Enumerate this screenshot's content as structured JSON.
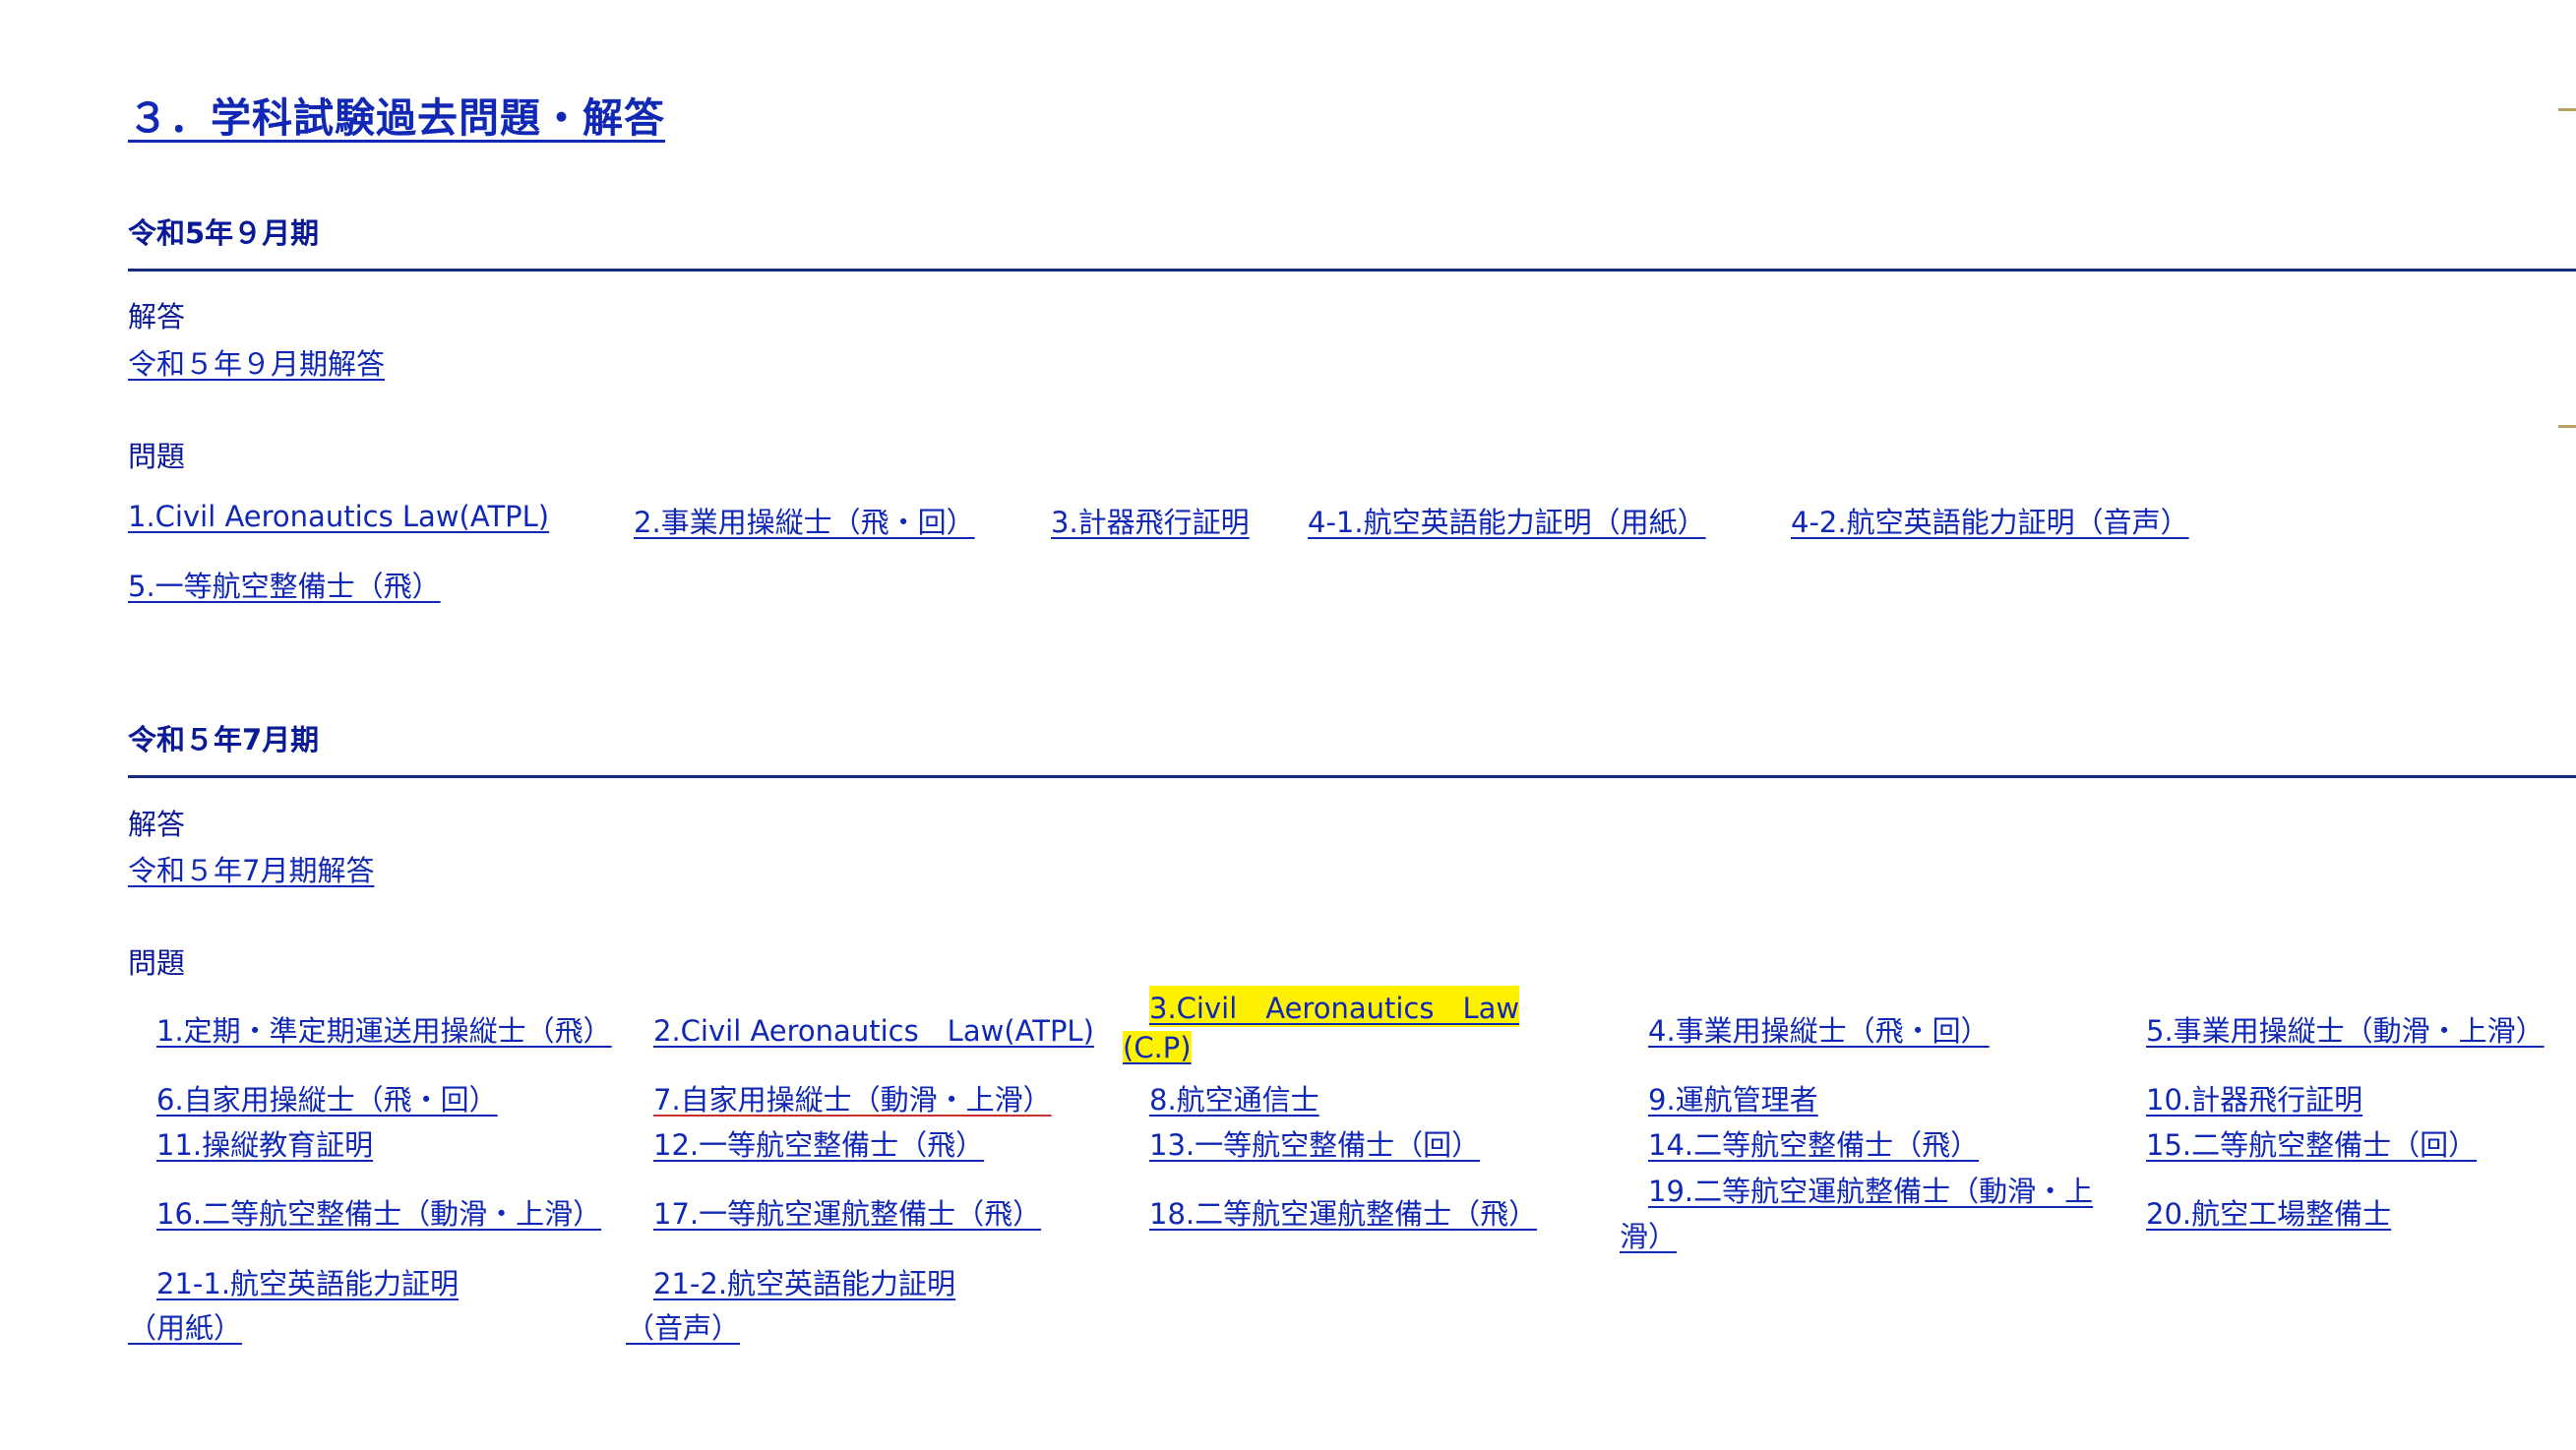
{
  "page": {
    "title": "３．学科試験過去問題・解答"
  },
  "periods": [
    {
      "title": "令和5年９月期",
      "answer_label": "解答",
      "answer_link": "令和５年９月期解答",
      "questions_label": "問題",
      "questions": [
        "1.Civil Aeronautics Law(ATPL)",
        "2.事業用操縦士（飛・回）",
        "3.計器飛行証明",
        "4-1.航空英語能力証明（用紙）",
        "4-2.航空英語能力証明（音声）",
        "5.一等航空整備士（飛）"
      ]
    },
    {
      "title": "令和５年7月期",
      "answer_label": "解答",
      "answer_link": "令和５年7月期解答",
      "questions_label": "問題",
      "questions": [
        "1.定期・準定期運送用操縦士（飛）",
        "2.Civil Aeronautics　Law(ATPL)",
        "3.Civil　Aeronautics　Law",
        "(C.P)",
        "4.事業用操縦士（飛・回）",
        "5.事業用操縦士（動滑・上滑）",
        "6.自家用操縦士（飛・回）",
        "7.自家用操縦士（動滑・上滑）",
        "8.航空通信士",
        "9.運航管理者",
        "10.計器飛行証明",
        "11.操縦教育証明",
        "12.一等航空整備士（飛）",
        "13.一等航空整備士（回）",
        "14.二等航空整備士（飛）",
        "15.二等航空整備士（回）",
        "16.二等航空整備士（動滑・上滑）",
        "17.一等航空運航整備士（飛）",
        "18.二等航空運航整備士（飛）",
        "19.二等航空運航整備士（動滑・上",
        "滑）",
        "20.航空工場整備士",
        "21-1.航空英語能力証明",
        "（用紙）",
        "21-2.航空英語能力証明",
        "（音声）"
      ]
    }
  ],
  "colors": {
    "link": "#1028b4",
    "heading": "#0a1a96",
    "rule": "#17277f",
    "highlight": "#fff200",
    "accent_tick": "#b8a060"
  }
}
